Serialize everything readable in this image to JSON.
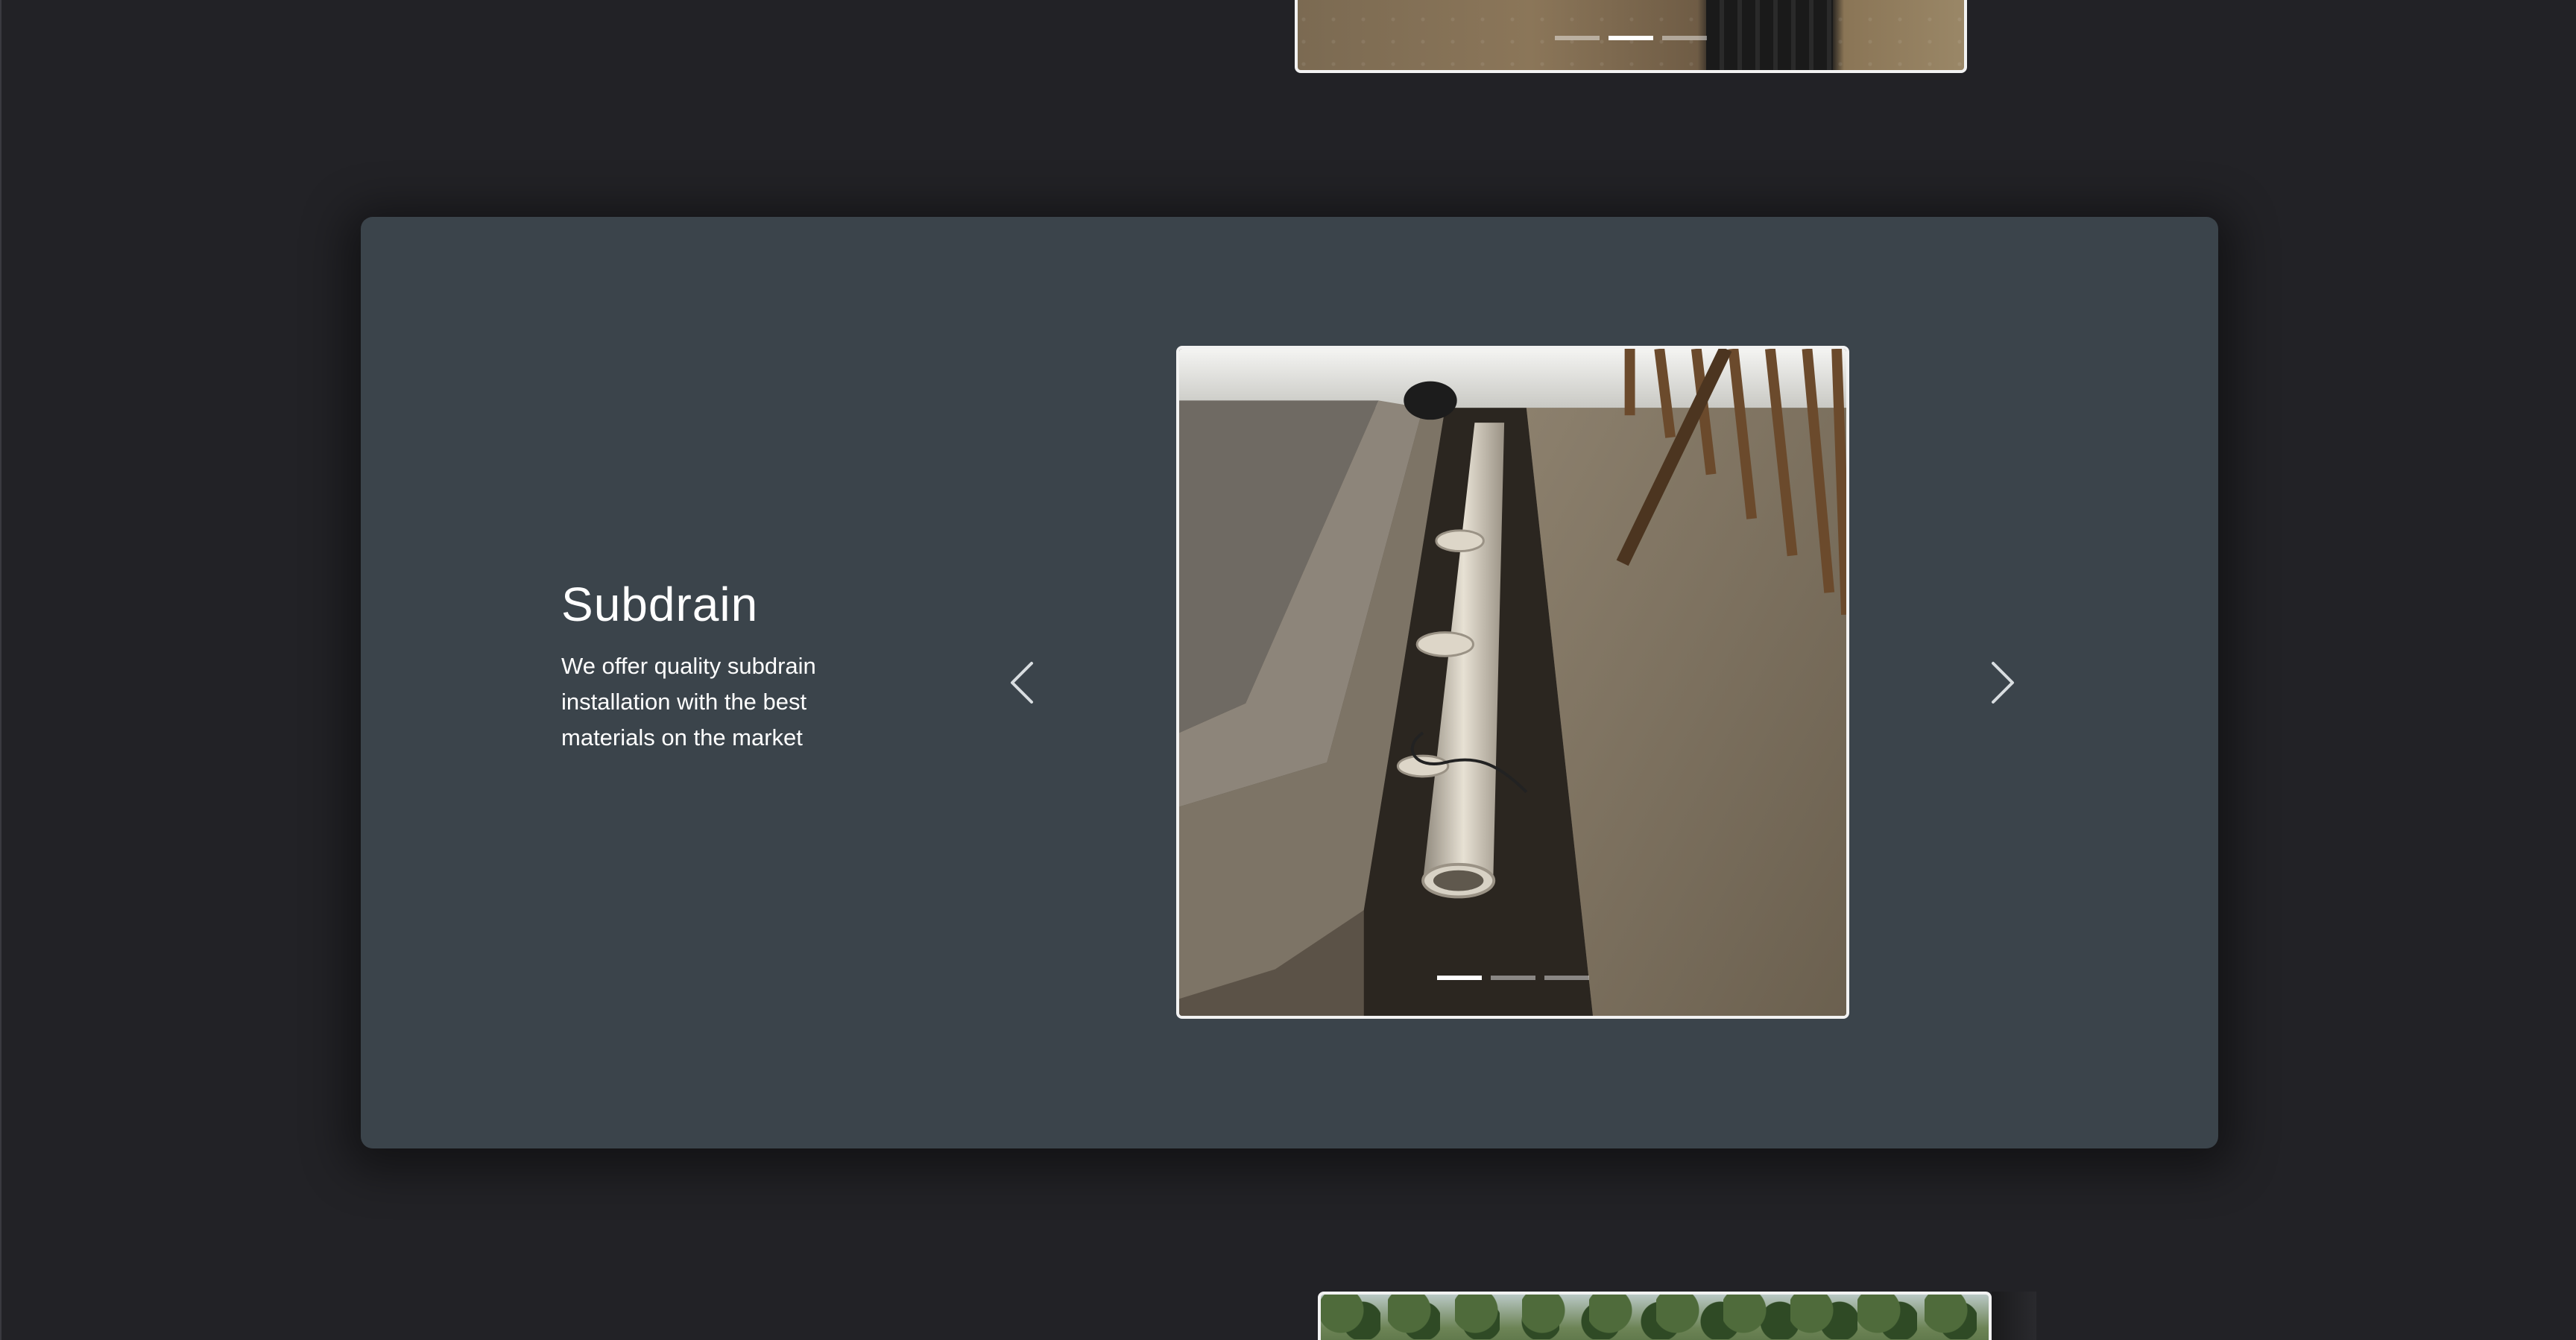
{
  "service": {
    "title": "Subdrain",
    "description": "We offer quality subdrain installation with the best materials on the market"
  },
  "carousel": {
    "prev_icon": "chevron-left-icon",
    "next_icon": "chevron-right-icon",
    "slide_count": 3,
    "active_slide": 1
  },
  "colors": {
    "page_background": "#222226",
    "card_background": "#3b444b",
    "text": "#ffffff",
    "photo_border": "#f2f2f2"
  }
}
